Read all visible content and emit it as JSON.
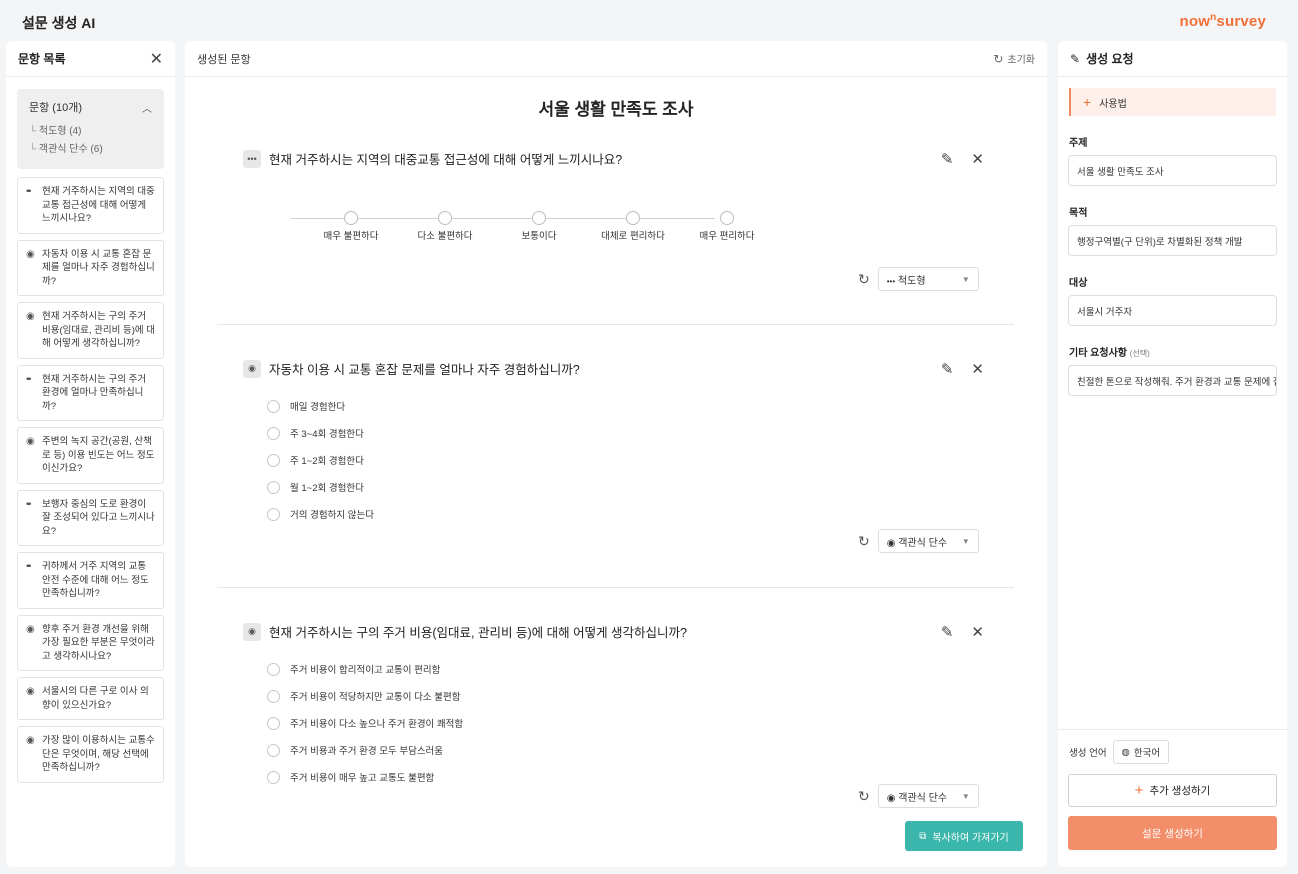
{
  "app": {
    "title": "설문 생성 AI",
    "brand_prefix": "now",
    "brand_sup": "n",
    "brand_suffix": "survey"
  },
  "left": {
    "title": "문항 목록",
    "summary_title": "문항 (10개)",
    "summary_items": [
      "척도형 (4)",
      "객관식 단수 (6)"
    ],
    "items": [
      {
        "type": "scale",
        "text": "현재 거주하시는 지역의 대중교통 접근성에 대해 어떻게 느끼시나요?"
      },
      {
        "type": "radio",
        "text": "자동차 이용 시 교통 혼잡 문제를 얼마나 자주 경험하십니까?"
      },
      {
        "type": "radio",
        "text": "현재 거주하시는 구의 주거 비용(임대료, 관리비 등)에 대해 어떻게 생각하십니까?"
      },
      {
        "type": "scale",
        "text": "현재 거주하시는 구의 주거 환경에 얼마나 만족하십니까?"
      },
      {
        "type": "radio",
        "text": "주변의 녹지 공간(공원, 산책로 등) 이용 빈도는 어느 정도이신가요?"
      },
      {
        "type": "scale",
        "text": "보행자 중심의 도로 환경이 잘 조성되어 있다고 느끼시나요?"
      },
      {
        "type": "scale",
        "text": "귀하께서 거주 지역의 교통 안전 수준에 대해 어느 정도 만족하십니까?"
      },
      {
        "type": "radio",
        "text": "향후 주거 환경 개선을 위해 가장 필요한 부분은 무엇이라고 생각하시나요?"
      },
      {
        "type": "radio",
        "text": "서울시의 다른 구로 이사 의향이 있으신가요?"
      },
      {
        "type": "radio",
        "text": "가장 많이 이용하시는 교통수단은 무엇이며, 해당 선택에 만족하십니까?"
      }
    ]
  },
  "center": {
    "title": "생성된 문항",
    "reset_label": "초기화",
    "survey_title": "서울 생활 만족도 조사",
    "questions": [
      {
        "text": "현재 거주하시는 지역의 대중교통 접근성에 대해 어떻게 느끼시나요?",
        "type_label": "척도형",
        "scale": [
          "매우 불편하다",
          "다소 불편하다",
          "보통이다",
          "대체로 편리하다",
          "매우 편리하다"
        ]
      },
      {
        "text": "자동차 이용 시 교통 혼잡 문제를 얼마나 자주 경험하십니까?",
        "type_label": "객관식 단수",
        "options": [
          "매일 경험한다",
          "주 3~4회 경험한다",
          "주 1~2회 경험한다",
          "월 1~2회 경험한다",
          "거의 경험하지 않는다"
        ]
      },
      {
        "text": "현재 거주하시는 구의 주거 비용(임대료, 관리비 등)에 대해 어떻게 생각하십니까?",
        "type_label": "객관식 단수",
        "options": [
          "주거 비용이 합리적이고 교통이 편리함",
          "주거 비용이 적당하지만 교통이 다소 불편함",
          "주거 비용이 다소 높으나 주거 환경이 쾌적함",
          "주거 비용과 주거 환경 모두 부담스러움",
          "주거 비용이 매우 높고 교통도 불편함"
        ]
      }
    ],
    "copy_button": "복사하여 가져가기"
  },
  "right": {
    "title": "생성 요청",
    "usage_label": "사용법",
    "topic_label": "주제",
    "topic_value": "서울 생활 만족도 조사",
    "purpose_label": "목적",
    "purpose_value": "행정구역별(구 단위)로 차별화된 정책 개발",
    "target_label": "대상",
    "target_value": "서울시 거주자",
    "extra_label": "기타 요청사항",
    "extra_note": "(선택)",
    "extra_value": "친절한 톤으로 작성해줘. 주거 환경과 교통 문제에 집",
    "lang_label": "생성 언어",
    "lang_value": "한국어",
    "add_button": "추가 생성하기",
    "generate_button": "설문 생성하기"
  }
}
